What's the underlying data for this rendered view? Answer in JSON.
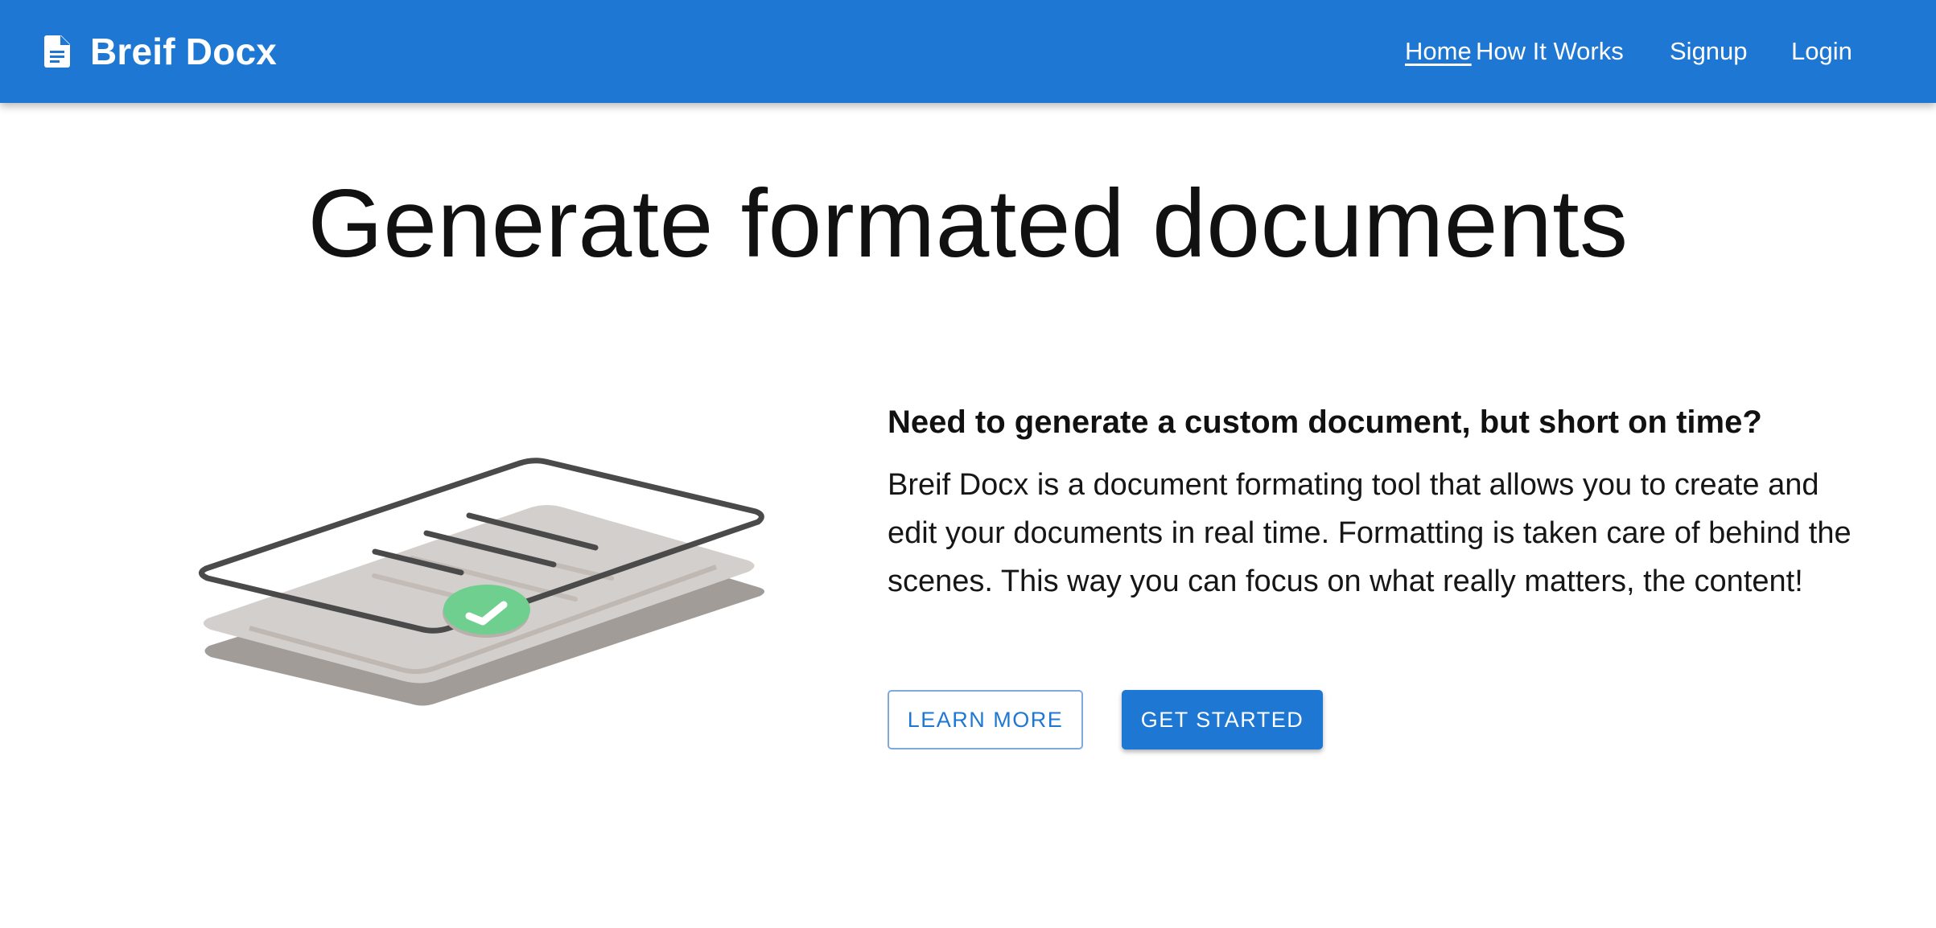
{
  "header": {
    "brand_name": "Breif Docx",
    "brand_icon": "document-icon",
    "nav": [
      {
        "label": "Home",
        "active": true
      },
      {
        "label": "How It Works",
        "active": false
      },
      {
        "label": "Signup",
        "active": false
      },
      {
        "label": "Login",
        "active": false
      }
    ]
  },
  "hero": {
    "title": "Generate formated documents"
  },
  "feature": {
    "illustration_icon": "document-stack-check-icon",
    "heading": "Need to generate a custom document, but short on time?",
    "body": "Breif Docx is a document formating tool that allows you to create and edit your documents in real time. Formatting is taken care of behind the scenes. This way you can focus on what really matters, the content!",
    "learn_more_label": "LEARN MORE",
    "get_started_label": "GET STARTED"
  },
  "colors": {
    "primary": "#1e78d3",
    "check_green": "#6fcf8f",
    "paper_light": "#d3cfcc",
    "paper_shadow": "#a29c98",
    "outline_dark": "#4a4a4a"
  }
}
